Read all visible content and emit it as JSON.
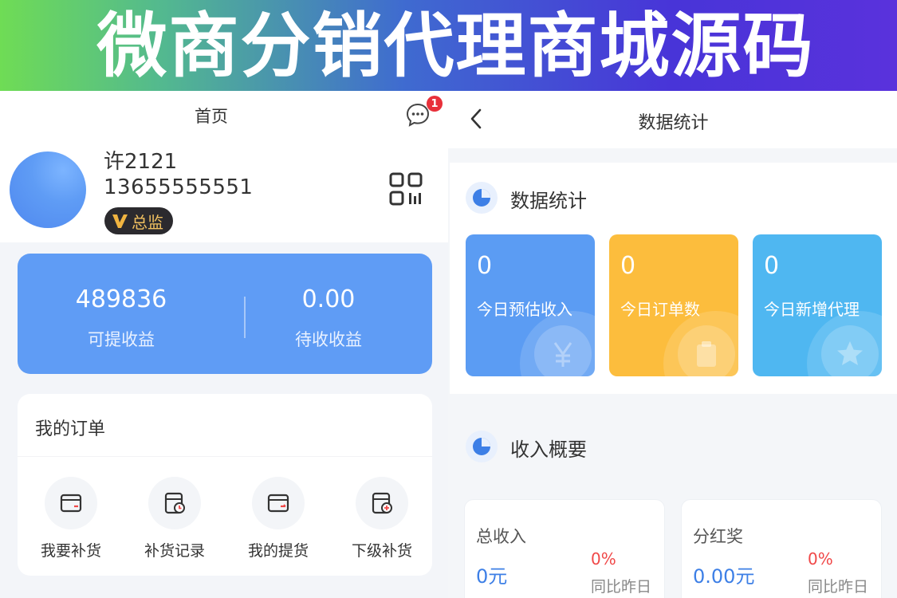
{
  "banner": {
    "title": "微商分销代理商城源码"
  },
  "home": {
    "title": "首页",
    "message_badge": "1",
    "user": {
      "name": "许2121",
      "phone": "13655555551",
      "level_badge": "总监"
    },
    "earnings": [
      {
        "value": "489836",
        "label": "可提收益"
      },
      {
        "value": "0.00",
        "label": "待收收益"
      }
    ],
    "orders": {
      "title": "我的订单",
      "items": [
        {
          "label": "我要补货",
          "icon": "restock-icon"
        },
        {
          "label": "补货记录",
          "icon": "restock-record-icon"
        },
        {
          "label": "我的提货",
          "icon": "pickup-icon"
        },
        {
          "label": "下级补货",
          "icon": "subordinate-restock-icon"
        }
      ]
    }
  },
  "stats": {
    "title": "数据统计",
    "section_title": "数据统计",
    "cards": [
      {
        "value": "0",
        "label": "今日预估收入",
        "color": "#5b9cf3",
        "icon": "yen-icon"
      },
      {
        "value": "0",
        "label": "今日订单数",
        "color": "#fcbd3d",
        "icon": "clipboard-icon"
      },
      {
        "value": "0",
        "label": "今日新增代理",
        "color": "#4fb7f1",
        "icon": "star-icon"
      }
    ],
    "income_title": "收入概要",
    "income": [
      {
        "label": "总收入",
        "value": "0元",
        "change": "0%",
        "compare": "同比昨日"
      },
      {
        "label": "分红奖",
        "value": "0.00元",
        "change": "0%",
        "compare": "同比昨日"
      }
    ]
  }
}
